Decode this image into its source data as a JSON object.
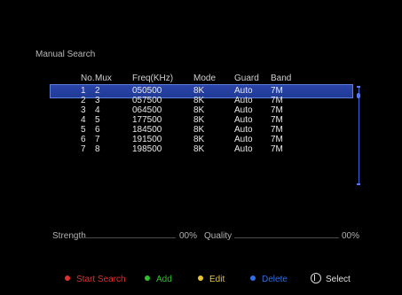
{
  "title": "Manual Search",
  "table": {
    "headers": [
      "No.",
      "Mux",
      "Freq(KHz)",
      "Mode",
      "Guard",
      "Band"
    ],
    "rows": [
      [
        "1",
        "2",
        "050500",
        "8K",
        "Auto",
        "7M"
      ],
      [
        "2",
        "3",
        "057500",
        "8K",
        "Auto",
        "7M"
      ],
      [
        "3",
        "4",
        "064500",
        "8K",
        "Auto",
        "7M"
      ],
      [
        "4",
        "5",
        "177500",
        "8K",
        "Auto",
        "7M"
      ],
      [
        "5",
        "6",
        "184500",
        "8K",
        "Auto",
        "7M"
      ],
      [
        "6",
        "7",
        "191500",
        "8K",
        "Auto",
        "7M"
      ],
      [
        "7",
        "8",
        "198500",
        "8K",
        "Auto",
        "7M"
      ]
    ],
    "selected_row": 0
  },
  "signal": {
    "strength_label": "Strength",
    "strength_value": "00%",
    "quality_label": "Quality",
    "quality_value": "00%"
  },
  "footer": {
    "start_search": "Start Search",
    "add": "Add",
    "edit": "Edit",
    "delete": "Delete",
    "select": "Select"
  },
  "colors": {
    "red": "#e03030",
    "green": "#2ec02e",
    "yellow": "#e8c430",
    "blue": "#2d6fe8",
    "selected_row": "#2a45a8"
  },
  "icons": {
    "select": "ok-knob-icon"
  }
}
